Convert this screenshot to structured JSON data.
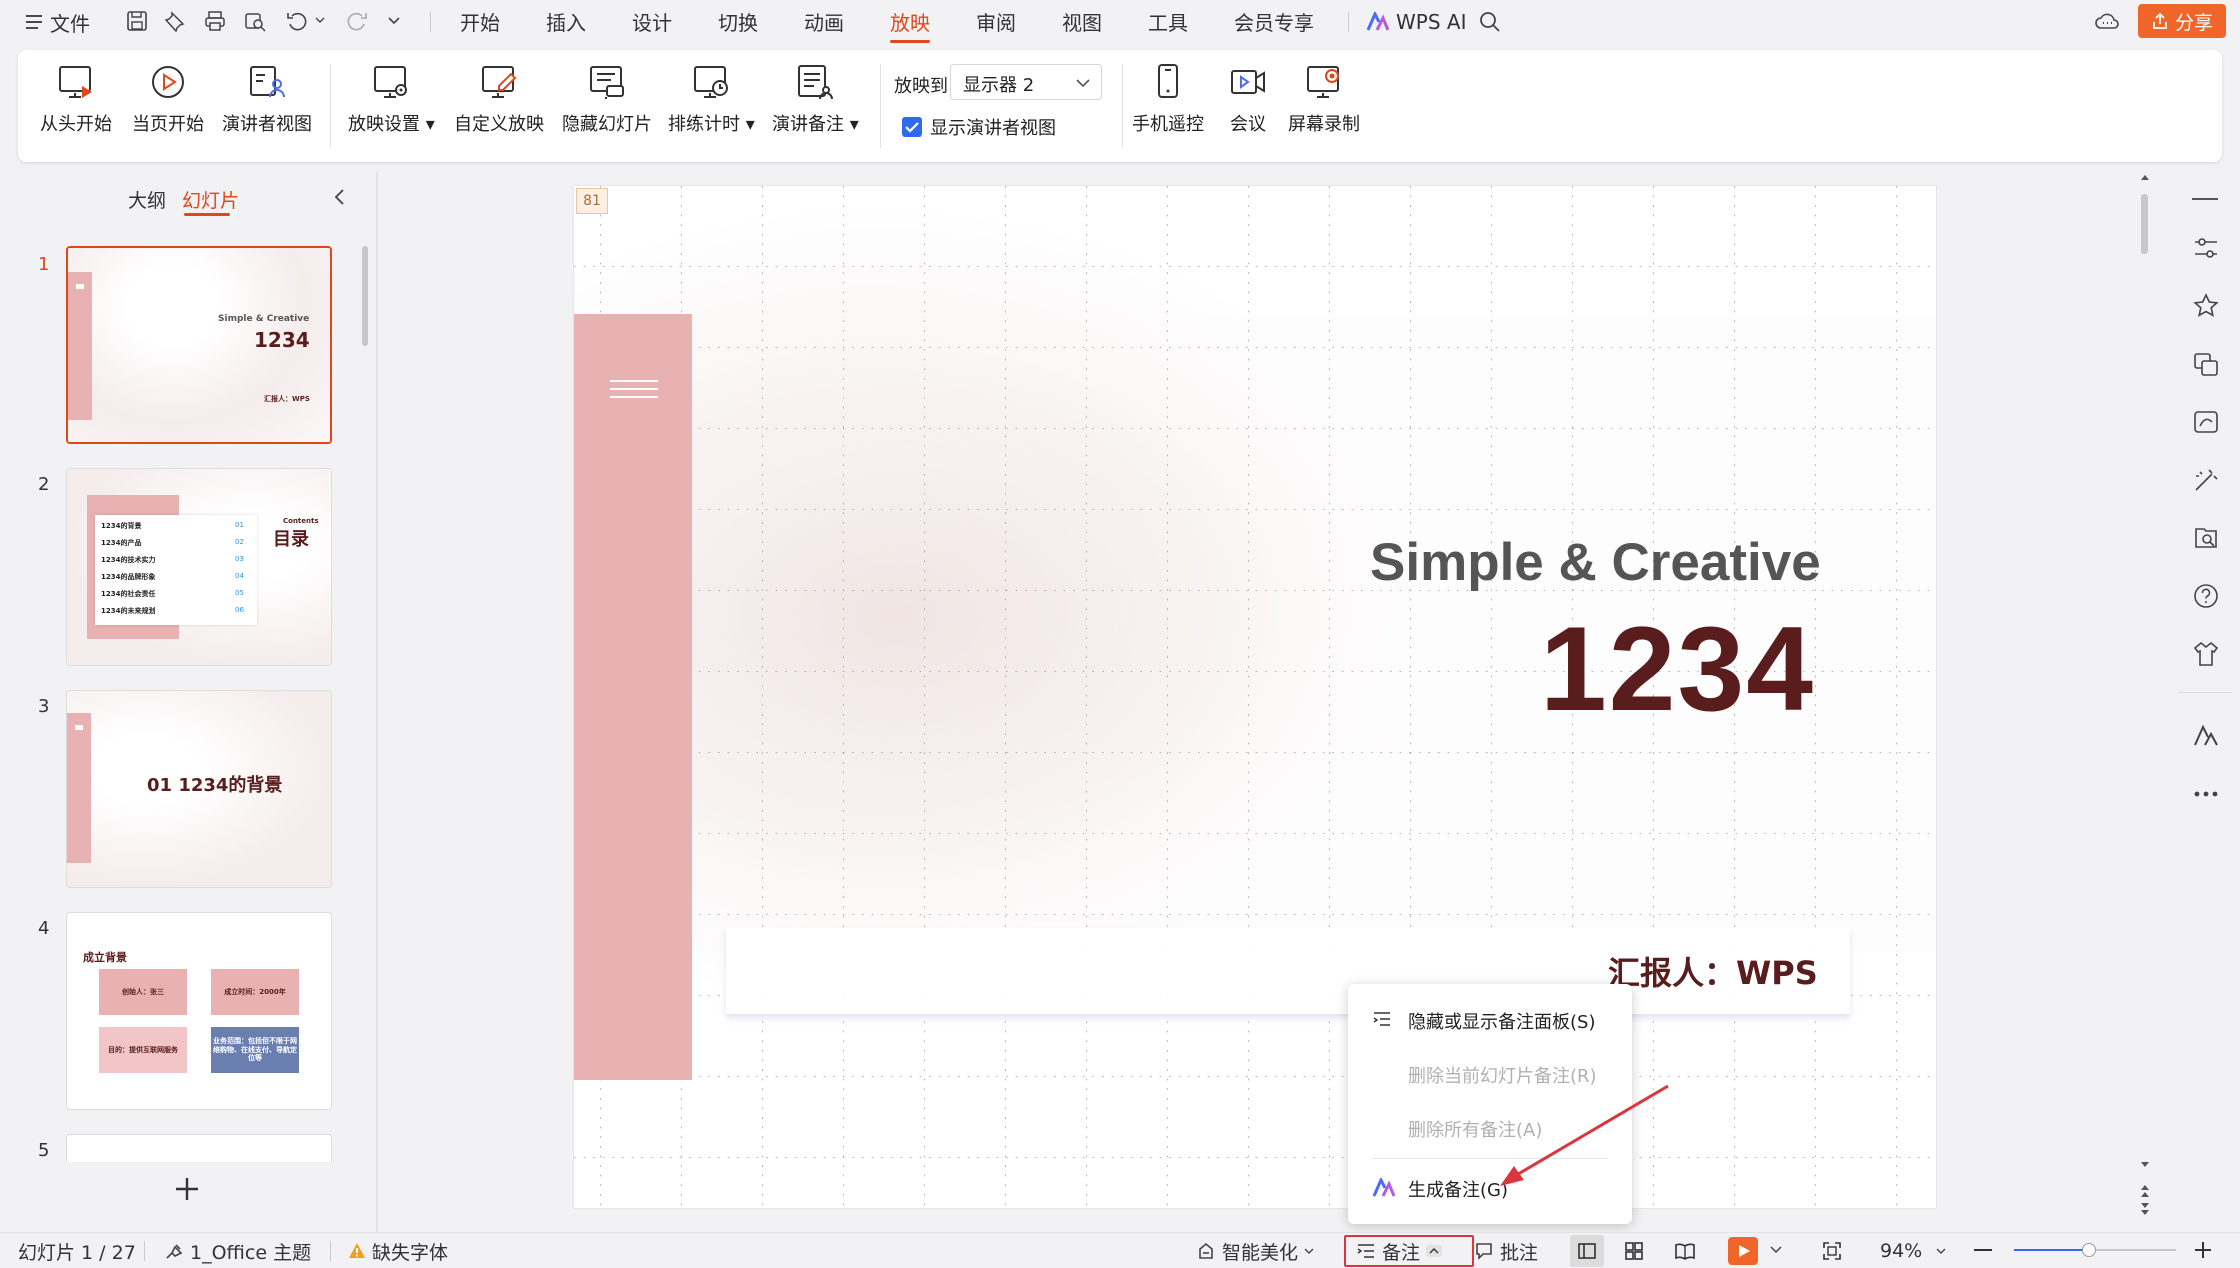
{
  "titlebar": {
    "file_label": "文件",
    "tabs": [
      {
        "label": "开始"
      },
      {
        "label": "插入"
      },
      {
        "label": "设计"
      },
      {
        "label": "切换"
      },
      {
        "label": "动画"
      },
      {
        "label": "放映",
        "active": true
      },
      {
        "label": "审阅"
      },
      {
        "label": "视图"
      },
      {
        "label": "工具"
      },
      {
        "label": "会员专享"
      }
    ],
    "wps_ai": "WPS AI",
    "share": "分享",
    "accent_color": "#e0471d",
    "share_color": "#f0652a"
  },
  "ribbon": {
    "from_start": "从头开始",
    "from_current": "当页开始",
    "presenter_view": "演讲者视图",
    "slideshow_settings": "放映设置",
    "custom_show": "自定义放映",
    "hide_slide": "隐藏幻灯片",
    "rehearse": "排练计时",
    "speaker_notes": "演讲备注",
    "show_to_label": "放映到",
    "show_to_value": "显示器 2",
    "show_presenter_checkbox": "显示演讲者视图",
    "show_presenter_checked": true,
    "phone_remote": "手机遥控",
    "meeting": "会议",
    "screen_record": "屏幕录制"
  },
  "left_panel": {
    "tab_outline": "大纲",
    "tab_slides": "幻灯片",
    "slides": [
      {
        "num": "1",
        "title_en": "Simple & Creative",
        "title": "1234",
        "reporter": "汇报人：WPS"
      },
      {
        "num": "2",
        "contents_en": "Contents",
        "contents": "目录",
        "items": [
          {
            "text": "1234的背景",
            "n": "01"
          },
          {
            "text": "1234的产品",
            "n": "02"
          },
          {
            "text": "1234的技术实力",
            "n": "03"
          },
          {
            "text": "1234的品牌形象",
            "n": "04"
          },
          {
            "text": "1234的社会责任",
            "n": "05"
          },
          {
            "text": "1234的未来规划",
            "n": "06"
          }
        ]
      },
      {
        "num": "3",
        "title": "01 1234的背景"
      },
      {
        "num": "4",
        "title": "成立背景",
        "boxes": [
          "创始人：张三",
          "成立时间：2000年",
          "目的：提供互联网服务",
          "业务范围：包括但不限于网络购物、在线支付、导航定位等"
        ]
      },
      {
        "num": "5"
      }
    ]
  },
  "slide": {
    "badge": "81",
    "title_en": "Simple & Creative",
    "title": "1234",
    "reporter": "汇报人：WPS",
    "pink_color": "#e8b2b2",
    "title_color": "#5a1d1d"
  },
  "popup": {
    "toggle_panel": "隐藏或显示备注面板(S)",
    "delete_current": "删除当前幻灯片备注(R)",
    "delete_all": "删除所有备注(A)",
    "generate": "生成备注(G)"
  },
  "status": {
    "slide_counter": "幻灯片 1 / 27",
    "theme": "1_Office 主题",
    "missing_font": "缺失字体",
    "beautify": "智能美化",
    "notes": "备注",
    "comments": "批注",
    "zoom": "94%"
  }
}
